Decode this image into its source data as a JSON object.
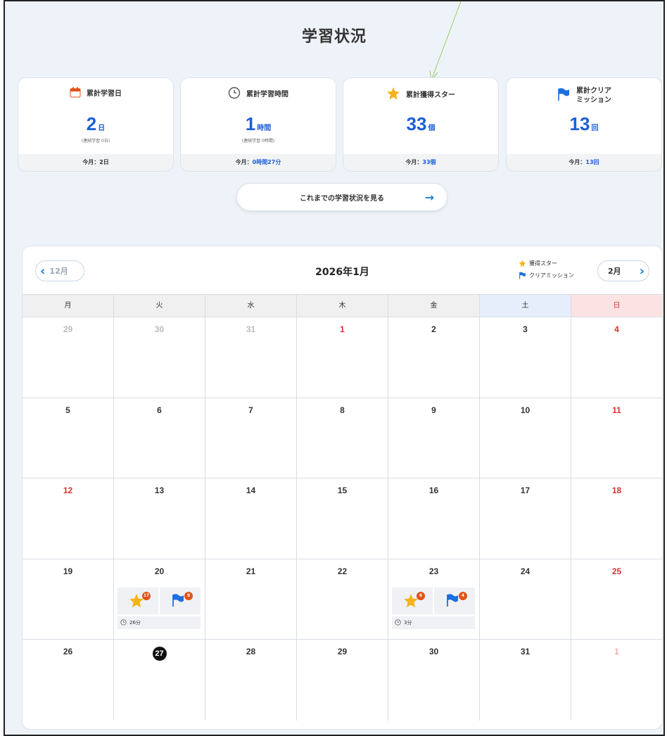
{
  "page": {
    "title": "学習状況"
  },
  "stats": [
    {
      "icon": "calendar-icon",
      "label": "累計学習日",
      "value": "2",
      "unit": "日",
      "sub": "(連続学習 0日)",
      "footer_prefix": "今月：",
      "footer_value": "2日"
    },
    {
      "icon": "clock-icon",
      "label": "累計学習時間",
      "value": "1",
      "unit": "時間",
      "sub": "(連続学習 0時間)",
      "footer_prefix": "今月：",
      "footer_value": "0時間27分"
    },
    {
      "icon": "star-icon",
      "label": "累計獲得スター",
      "value": "33",
      "unit": "個",
      "sub": "",
      "footer_prefix": "今月：",
      "footer_value": "33個"
    },
    {
      "icon": "flag-icon",
      "label_line1": "累計クリア",
      "label_line2": "ミッション",
      "value": "13",
      "unit": "回",
      "sub": "",
      "footer_prefix": "今月：",
      "footer_value": "13回"
    }
  ],
  "history_button": {
    "label": "これまでの学習状況を見る",
    "icon": "arrow-right-icon"
  },
  "calendar": {
    "title": "2026年1月",
    "prev_label": "12月",
    "next_label": "2月",
    "legend": {
      "star": "獲得スター",
      "flag": "クリアミッション"
    },
    "weekdays": [
      "月",
      "火",
      "水",
      "木",
      "金",
      "土",
      "日"
    ],
    "weeks": [
      [
        "29",
        "30",
        "31",
        "1",
        "2",
        "3",
        "4"
      ],
      [
        "5",
        "6",
        "7",
        "8",
        "9",
        "10",
        "11"
      ],
      [
        "12",
        "13",
        "14",
        "15",
        "16",
        "17",
        "18"
      ],
      [
        "19",
        "20",
        "21",
        "22",
        "23",
        "24",
        "25"
      ],
      [
        "26",
        "27",
        "28",
        "29",
        "30",
        "31",
        "1"
      ]
    ],
    "activity": {
      "jan20": {
        "stars": "17",
        "flags": "9",
        "time": "26分"
      },
      "jan23": {
        "stars": "6",
        "flags": "4",
        "time": "3分"
      }
    }
  },
  "colors": {
    "accent": "#1d5fd6",
    "sunday": "#e02f2f",
    "badge": "#e0531a",
    "star": "#f5b31a",
    "flag": "#1d6fe0"
  }
}
